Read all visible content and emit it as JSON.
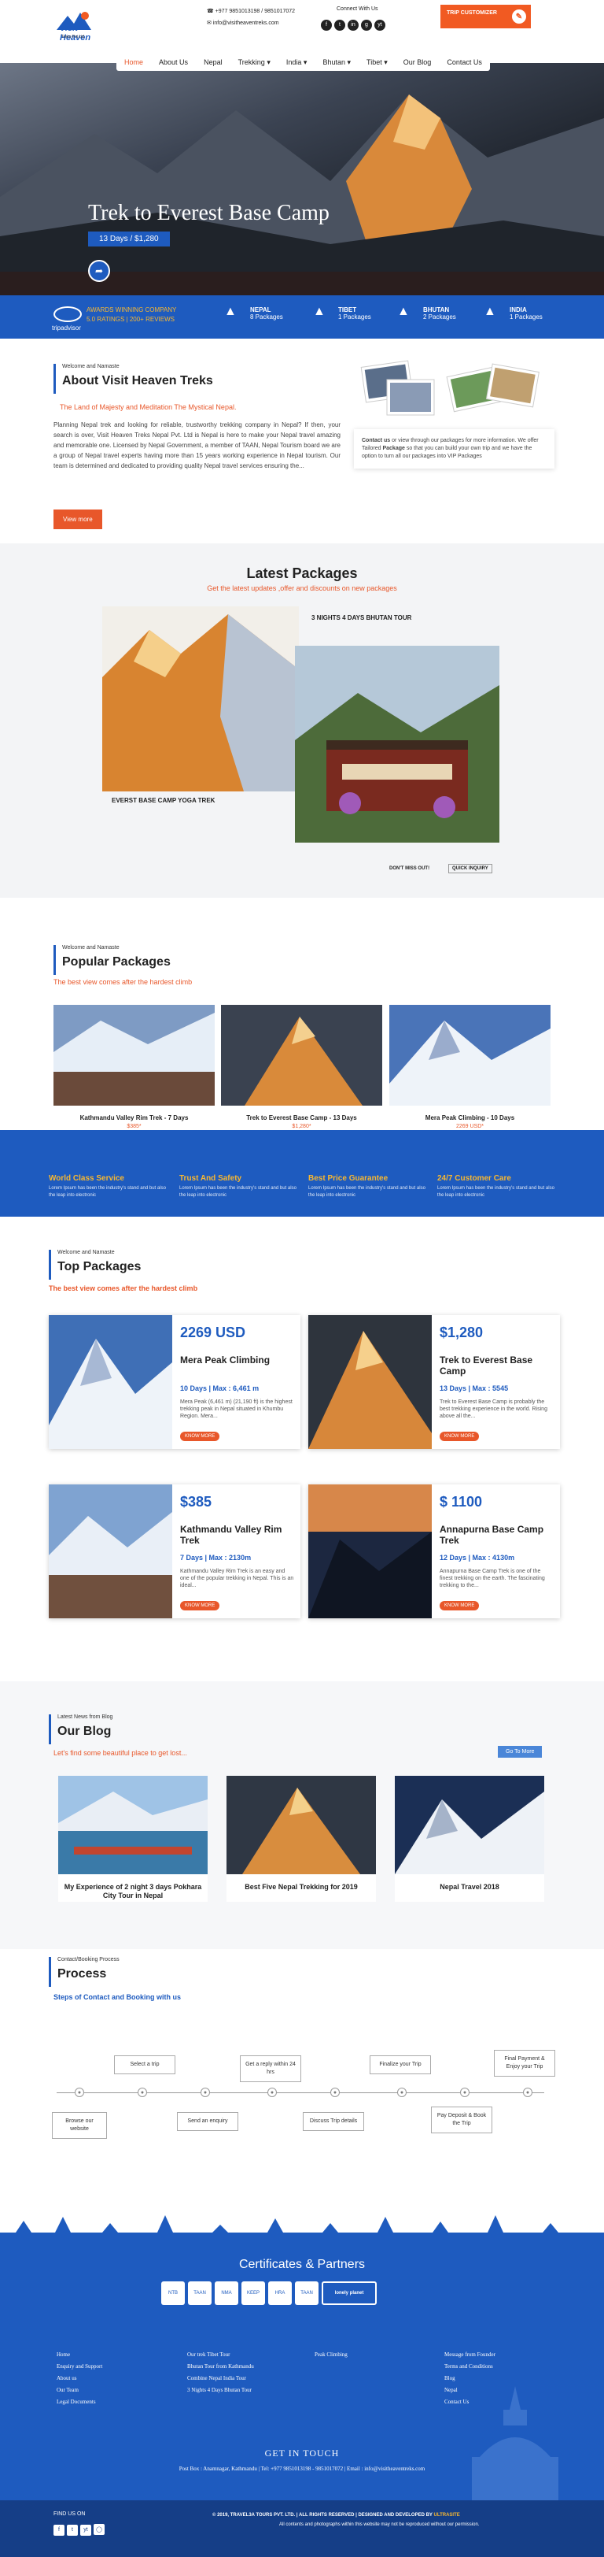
{
  "header": {
    "logo_text": "Visit Heaven",
    "logo_sub": "Treks Pvt Ltd",
    "phone": "+977 9851013198 / 9851017072",
    "email": "info@visitheaventreks.com",
    "connect_label": "Connect With Us",
    "social_icons": [
      "f",
      "t",
      "in",
      "g",
      "yt"
    ],
    "trip_button": "TRIP CUSTOMIZER",
    "nav": [
      "Home",
      "About Us",
      "Nepal",
      "Trekking",
      "India",
      "Bhutan",
      "Tibet",
      "Our Blog",
      "Contact Us"
    ]
  },
  "hero": {
    "title": "Trek to Everest Base Camp",
    "badge": "13 Days / $1,280"
  },
  "awards": {
    "tripadvisor": "tripadvisor",
    "line1": "AWARDS WINNING COMPANY",
    "line2": "5.0 RATINGS | 200+ REVIEWS",
    "items": [
      {
        "name": "NEPAL",
        "count": "8 Packages"
      },
      {
        "name": "TIBET",
        "count": "1 Packages"
      },
      {
        "name": "BHUTAN",
        "count": "2 Packages"
      },
      {
        "name": "INDIA",
        "count": "1 Packages"
      }
    ]
  },
  "about": {
    "welcome": "Welcome and Namaste",
    "title": "About Visit Heaven Treks",
    "tagline": "The Land of Majesty and Meditation The Mystical Nepal.",
    "text": "Planning Nepal trek and looking for reliable, trustworthy trekking company in Nepal? If then, your search is over, Visit Heaven Treks Nepal Pvt. Ltd is Nepal is here to make your Nepal travel amazing and memorable one. Licensed by Nepal Government, a member of TAAN, Nepal Tourism board we are a group of Nepal travel experts having more than 15 years working experience in Nepal tourism. Our team is determined and dedicated to providing quality Nepal travel services ensuring the...",
    "button": "View more",
    "side_text_a": "Contact us",
    "side_text_b": " or view through our packages for more information. We offer Tailored ",
    "side_text_c": "Package",
    "side_text_d": " so that you can build your own trip and we have the option to turn all our packages into VIP Packages"
  },
  "latest": {
    "title": "Latest Packages",
    "subtitle": "Get the latest updates ,offer and discounts on new packages",
    "pkg1": "EVERST BASE CAMP YOGA TREK",
    "pkg2": "3 NIGHTS 4 DAYS BHUTAN TOUR",
    "tag1": "DON'T MISS OUT!",
    "tag2": "QUICK INQUIRY"
  },
  "popular": {
    "welcome": "Welcome and Namaste",
    "title": "Popular Packages",
    "subtitle": "The best view comes after the hardest climb",
    "items": [
      {
        "name": "Kathmandu Valley Rim Trek - 7 Days",
        "price": "$385*"
      },
      {
        "name": "Trek to Everest Base Camp - 13 Days",
        "price": "$1,280*"
      },
      {
        "name": "Mera Peak Climbing - 10 Days",
        "price": "2269 USD*"
      }
    ]
  },
  "features": [
    {
      "title": "World Class Service",
      "text": "Lorem Ipsum has been the industry's stand and but also the leap into electronic"
    },
    {
      "title": "Trust And Safety",
      "text": "Lorem Ipsum has been the industry's stand and but also the leap into electronic"
    },
    {
      "title": "Best Price Guarantee",
      "text": "Lorem Ipsum has been the industry's stand and but also the leap into electronic"
    },
    {
      "title": "24/7 Customer Care",
      "text": "Lorem Ipsum has been the industry's stand and but also the leap into electronic"
    }
  ],
  "top": {
    "welcome": "Welcome and Namaste",
    "title": "Top Packages",
    "subtitle": "The best view comes after the hardest climb",
    "button": "KNOW MORE",
    "cards": [
      {
        "price": "2269 USD",
        "name": "Mera Peak Climbing",
        "meta": "10 Days  |  Max : 6,461 m",
        "desc": "Mera Peak (6,461 m) (21,190 ft) is the highest trekking peak in Nepal situated in Khumbu Region. Mera..."
      },
      {
        "price": "$1,280",
        "name": "Trek to Everest Base Camp",
        "meta": "13 Days  |  Max : 5545",
        "desc": "Trek to Everest Base Camp is probably the best trekking experience in the world. Rising above all the..."
      },
      {
        "price": "$385",
        "name": "Kathmandu Valley Rim Trek",
        "meta": "7 Days  |  Max : 2130m",
        "desc": "Kathmandu Valley Rim Trek is an easy and one of the popular trekking in Nepal. This is an ideal..."
      },
      {
        "price": "$ 1100",
        "name": "Annapurna Base Camp Trek",
        "meta": "12 Days  |  Max : 4130m",
        "desc": "Annapurna Base Camp Trek is one of the finest trekking on the earth. The fascinating trekking to the..."
      }
    ]
  },
  "blog": {
    "label": "Latest News from Blog",
    "title": "Our Blog",
    "subtitle": "Let's find some beautiful place to get lost...",
    "button": "Go To More",
    "posts": [
      "My Experience of 2 night 3 days Pokhara City Tour in Nepal",
      "Best Five Nepal Trekking for 2019",
      "Nepal Travel 2018"
    ]
  },
  "process": {
    "label": "Contact/Booking Process",
    "title": "Process",
    "subtitle": "Steps of Contact and Booking with us",
    "top_steps": [
      "Select a trip",
      "Get a reply within 24 hrs",
      "Finalize your Trip",
      "Final Payment & Enjoy your Trip"
    ],
    "bottom_steps": [
      "Browse our website",
      "Send an enquiry",
      "Discuss Trip details",
      "Pay Deposit & Book the Trip"
    ]
  },
  "footer": {
    "partners_title": "Certificates & Partners",
    "partners": [
      "NTB",
      "TAAN",
      "NMA",
      "KEEP",
      "HRA",
      "TAAN",
      "lonely planet"
    ],
    "col1": [
      "Home",
      "Enquiry and Support",
      "About us",
      "Our Team",
      "Legal Documents"
    ],
    "col2": [
      "Our trek Tibet Tour",
      "Bhutan Tour from Kathmandu",
      "Combine Nepal India Tour",
      "3 Nights 4 Days Bhutan Tour"
    ],
    "col3": [
      "Peak Climbing"
    ],
    "col4": [
      "Message from Founder",
      "Terms and Conditions",
      "Blog",
      "Nepal",
      "Contact Us"
    ],
    "get_in_touch": "GET IN TOUCH",
    "address": "Post Box : Anamnagar, Kathmandu | Tel: +977 9851013198 - 9851017072 | Email : info@visitheaventreks.com",
    "find_us": "FIND US ON",
    "copyright": "© 2019, TRAVEL3A TOURS PVT. LTD.  |  ALL RIGHTS RESERVED  |  DESIGNED AND DEVELOPED BY",
    "developer": "ULTRASITE",
    "notice": "All contents and photographs within this website may not be reproduced without our permission."
  }
}
